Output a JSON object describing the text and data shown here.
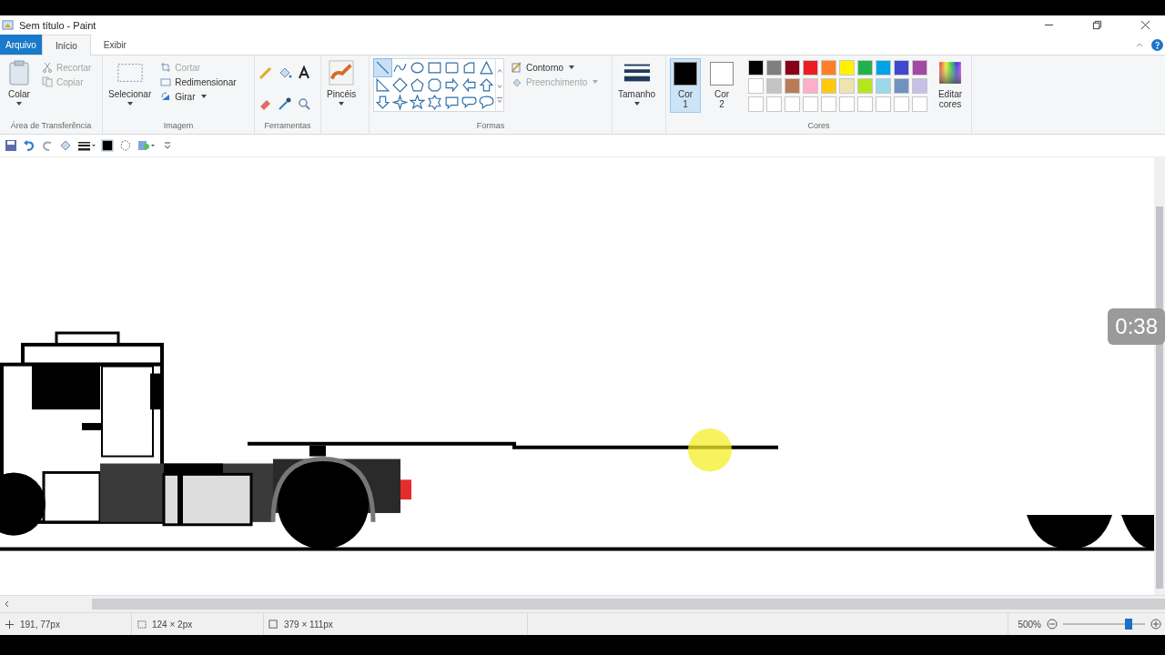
{
  "window": {
    "title": "Sem título - Paint"
  },
  "tabs": [
    {
      "label": "Arquivo",
      "kind": "file",
      "selected": false
    },
    {
      "label": "Início",
      "kind": "tab",
      "selected": true
    },
    {
      "label": "Exibir",
      "kind": "tab",
      "selected": false
    }
  ],
  "ribbon": {
    "clipboard": {
      "label": "Área de Transferência",
      "paste": "Colar",
      "items": [
        {
          "label": "Recortar",
          "disabled": true
        },
        {
          "label": "Copiar",
          "disabled": true
        }
      ]
    },
    "image": {
      "label": "Imagem",
      "select": "Selecionar",
      "items": [
        {
          "label": "Cortar",
          "disabled": true
        },
        {
          "label": "Redimensionar",
          "disabled": false
        },
        {
          "label": "Girar",
          "disabled": false
        }
      ]
    },
    "tools": {
      "label": "Ferramentas"
    },
    "brushes": {
      "label": "Pincéis"
    },
    "shapes": {
      "label": "Formas",
      "items": [
        {
          "selected": true
        },
        {
          "selected": false
        },
        {
          "selected": false
        },
        {
          "selected": false
        },
        {
          "selected": false
        },
        {
          "selected": false
        },
        {
          "selected": false
        },
        {
          "selected": false
        },
        {
          "selected": false
        },
        {
          "selected": false
        },
        {
          "selected": false
        },
        {
          "selected": false
        },
        {
          "selected": false
        },
        {
          "selected": false
        },
        {
          "selected": false
        },
        {
          "selected": false
        },
        {
          "selected": false
        },
        {
          "selected": false
        },
        {
          "selected": false
        },
        {
          "selected": false
        },
        {
          "selected": false
        }
      ],
      "outline": {
        "label": "Contorno",
        "disabled": false
      },
      "fill": {
        "label": "Preenchimento",
        "disabled": true
      }
    },
    "size": {
      "label": "Tamanho"
    },
    "color1": {
      "label": "Cor",
      "number": "1",
      "color": "#000000",
      "selected": true
    },
    "color2": {
      "label": "Cor",
      "number": "2",
      "color": "#ffffff",
      "selected": false
    },
    "colors": {
      "label": "Cores",
      "edit": "Editar cores",
      "palette": [
        {
          "kind": "color",
          "color": "#000000"
        },
        {
          "kind": "color",
          "color": "#7f7f7f"
        },
        {
          "kind": "color",
          "color": "#880015"
        },
        {
          "kind": "color",
          "color": "#ed1c24"
        },
        {
          "kind": "color",
          "color": "#ff7f27"
        },
        {
          "kind": "color",
          "color": "#fff200"
        },
        {
          "kind": "color",
          "color": "#22b14c"
        },
        {
          "kind": "color",
          "color": "#00a2e8"
        },
        {
          "kind": "color",
          "color": "#3f48cc"
        },
        {
          "kind": "color",
          "color": "#a349a4"
        },
        {
          "kind": "color",
          "color": "#ffffff"
        },
        {
          "kind": "color",
          "color": "#c3c3c3"
        },
        {
          "kind": "color",
          "color": "#b97a57"
        },
        {
          "kind": "color",
          "color": "#ffaec9"
        },
        {
          "kind": "color",
          "color": "#ffc90e"
        },
        {
          "kind": "color",
          "color": "#efe4b0"
        },
        {
          "kind": "color",
          "color": "#b5e61d"
        },
        {
          "kind": "color",
          "color": "#99d9ea"
        },
        {
          "kind": "color",
          "color": "#7092be"
        },
        {
          "kind": "color",
          "color": "#c8bfe7"
        },
        {
          "kind": "empty"
        },
        {
          "kind": "empty"
        },
        {
          "kind": "empty"
        },
        {
          "kind": "empty"
        },
        {
          "kind": "empty"
        },
        {
          "kind": "empty"
        },
        {
          "kind": "empty"
        },
        {
          "kind": "empty"
        },
        {
          "kind": "empty"
        },
        {
          "kind": "empty"
        }
      ]
    }
  },
  "video_time": "0:38",
  "status_bar": {
    "cursor_position": "191, 77px",
    "selection_size": "124 × 2px",
    "image_size": "379 × 111px",
    "zoom": "500%",
    "zoom_slider": {
      "level": 0.8
    }
  }
}
